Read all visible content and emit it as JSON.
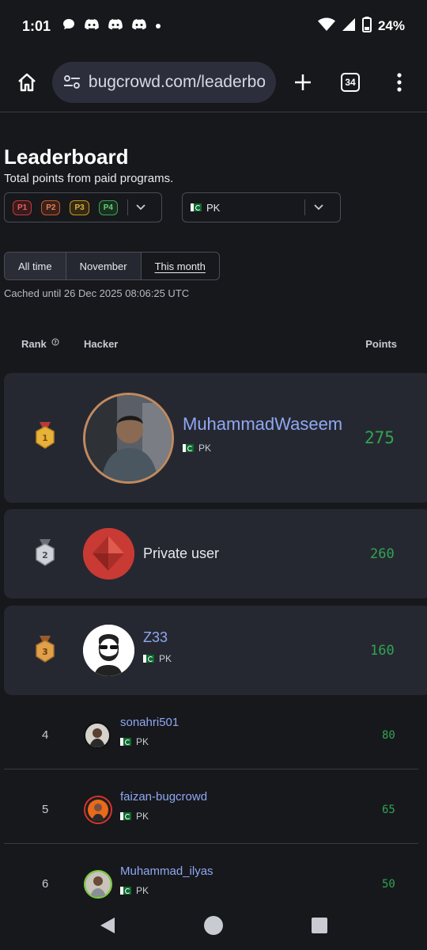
{
  "status_bar": {
    "time": "1:01",
    "battery": "24%",
    "notification_icons": [
      "chat-bubble-icon",
      "discord-icon",
      "discord-icon",
      "discord-icon",
      "dot-icon"
    ]
  },
  "browser": {
    "url": "bugcrowd.com/leaderbo",
    "tab_count": "34"
  },
  "page": {
    "title": "Leaderboard",
    "subtitle": "Total points from paid programs.",
    "priorities": [
      "P1",
      "P2",
      "P3",
      "P4"
    ],
    "country_filter": "PK",
    "time_tabs": [
      "All time",
      "November",
      "This month"
    ],
    "cached": "Cached until 26 Dec 2025 08:06:25 UTC"
  },
  "table": {
    "headers": {
      "rank": "Rank",
      "hacker": "Hacker",
      "points": "Points"
    },
    "top": [
      {
        "rank": "1",
        "name": "MuhammadWaseem",
        "country": "PK",
        "points": "275"
      },
      {
        "rank": "2",
        "name": "Private user",
        "country": "",
        "points": "260"
      },
      {
        "rank": "3",
        "name": "Z33",
        "country": "PK",
        "points": "160"
      }
    ],
    "rows": [
      {
        "rank": "4",
        "name": "sonahri501",
        "country": "PK",
        "points": "80"
      },
      {
        "rank": "5",
        "name": "faizan-bugcrowd",
        "country": "PK",
        "points": "65"
      },
      {
        "rank": "6",
        "name": "Muhammad_ilyas",
        "country": "PK",
        "points": "50"
      }
    ]
  },
  "colors": {
    "background": "#17181c",
    "card": "#262831",
    "link": "#8ea8f2",
    "points": "#2fa552",
    "p1": "#c43a3a",
    "p2": "#c85a2a",
    "p3": "#c7941e",
    "p4": "#3aa34e"
  }
}
